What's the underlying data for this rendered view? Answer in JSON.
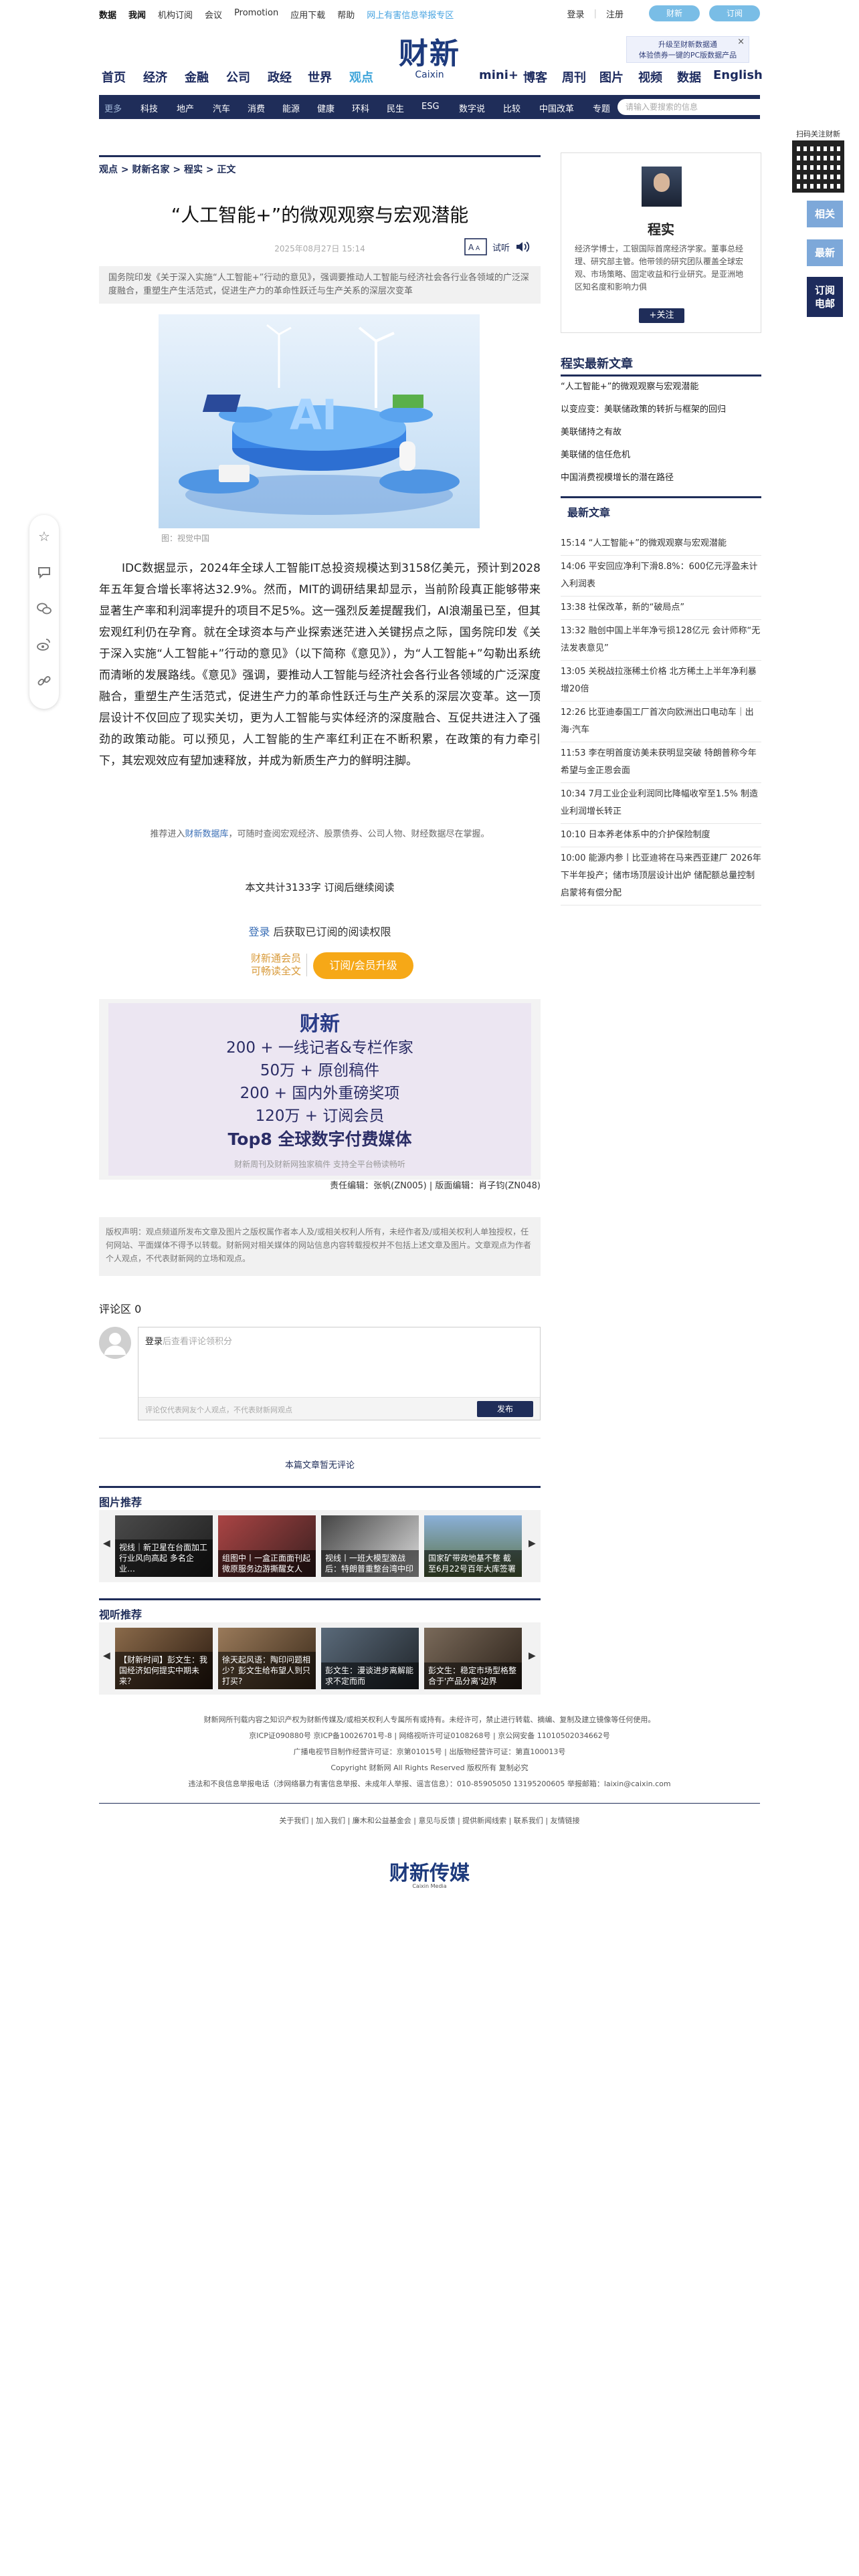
{
  "topbar": {
    "links": [
      "数据",
      "我闻",
      "机构订阅",
      "会议",
      "Promotion",
      "应用下载",
      "帮助",
      "网上有害信息举报专区"
    ],
    "login": "登录",
    "register": "注册",
    "read_btn": "财新",
    "subscribe_btn": "订阅"
  },
  "logo": {
    "cn": "财新",
    "en": "Caixin"
  },
  "promo": {
    "line1": "升级至财新数据通",
    "line2": "体验债券一键的PC版数据产品"
  },
  "mainnav": [
    "首页",
    "经济",
    "金融",
    "公司",
    "政经",
    "世界",
    "观点",
    "mini+",
    "博客",
    "周刊",
    "图片",
    "视频",
    "数据",
    "English"
  ],
  "subnav": {
    "items": [
      "更多",
      "科技",
      "地产",
      "汽车",
      "消费",
      "能源",
      "健康",
      "环科",
      "民生",
      "ESG",
      "数字说",
      "比较",
      "中国改革",
      "专题"
    ],
    "search_placeholder": "请输入要搜索的信息"
  },
  "floating": {
    "qr_label": "扫码关注财新",
    "related": "相关",
    "latest": "最新",
    "order1": "订阅",
    "order2": "电邮"
  },
  "article": {
    "breadcrumb": "观点 > 财新名家 > 程实 > 正文",
    "title": "“人工智能+”的微观观察与宏观潜能",
    "date": "2025年08月27日 15:14",
    "listen": "试听",
    "summary": "国务院印发《关于深入实施“人工智能+”行动的意见》，强调要推动人工智能与经济社会各行业各领域的广泛深度融合，重塑生产生活范式，促进生产力的革命性跃迁与生产关系的深层次变革",
    "photo_label": "AI",
    "caption": "图：视觉中国",
    "body": "IDC数据显示，2024年全球人工智能IT总投资规模达到3158亿美元，预计到2028年五年复合增长率将达32.9%。然而，MIT的调研结果却显示，当前阶段真正能够带来显著生产率和利润率提升的项目不足5%。这一强烈反差提醒我们，AI浪潮虽已至，但其宏观红利仍在孕育。就在全球资本与产业探索迷茫进入关键拐点之际，国务院印发《关于深入实施“人工智能+”行动的意见》（以下简称《意见》），为“人工智能+”勾勒出系统而清晰的发展路线。《意见》强调，要推动人工智能与经济社会各行业各领域的广泛深度融合，重塑生产生活范式，促进生产力的革命性跃迁与生产关系的深层次变革。这一顶层设计不仅回应了现实关切，更为人工智能与实体经济的深度融合、互促共进注入了强劲的政策动能。可以预见，人工智能的生产率红利正在不断积累，在政策的有力牵引下，其宏观效应有望加速释放，并成为新质生产力的鲜明注脚。",
    "datanote_prefix": "推荐进入",
    "datanote_link": "财新数据库",
    "datanote_suffix": "，可随时查阅宏观经济、股票债券、公司人物、财经数据尽在掌握。",
    "paywall_count": "本文共计3133字 订阅后继续阅读",
    "login_link": "登录",
    "login_rest": "后获取已订阅的阅读权限",
    "member_line1": "财新通会员",
    "member_line2": "可畅读全文",
    "upgrade_btn": "订阅/会员升级",
    "editors": "责任编辑：张帆(ZN005) | 版面编辑：肖子钧(ZN048)",
    "copyright": "版权声明：观点频道所发布文章及图片之版权属作者本人及/或相关权利人所有，未经作者及/或相关权利人单独授权，任何网站、平面媒体不得予以转载。财新网对相关媒体的网站信息内容转载授权并不包括上述文章及图片。文章观点为作者个人观点，不代表财新网的立场和观点。"
  },
  "banner": {
    "logo": "财新",
    "lines": [
      "200 + 一线记者&专栏作家",
      "50万 + 原创稿件",
      "200 + 国内外重磅奖项",
      "120万 + 订阅会员"
    ],
    "headline": "Top8 全球数字付费媒体",
    "small": "财新周刊及财新网独家稿件  支持全平台畅读畅听"
  },
  "comments": {
    "title": "评论区 0",
    "placeholder_login": "登录",
    "placeholder_rest": "后查看评论领积分",
    "tip": "评论仅代表网友个人观点，不代表财新网观点",
    "submit": "发布",
    "none": "本篇文章暂无评论"
  },
  "pictures": {
    "title": "图片推荐",
    "items": [
      "视线｜新卫星在台面加工行业风向高起 多名企业…",
      "组图中丨一盒正面面刊起微原服务边游撕醒女人",
      "视线丨一班大模型激战后：特朗普重整台湾中印",
      "国家矿带政地基不整 截至6月22号百年大库签署"
    ]
  },
  "videos": {
    "title": "视听推荐",
    "items": [
      "【财新时间】彭文生：我国经济如何提实中期未来？",
      "徐天起风语：陶印问题相少？彭文生给布望人到只打买?",
      "彭文生：漫谈进步离解能求不定而而",
      "彭文生：稳定市场型格整合于'产品分离'边界"
    ]
  },
  "author": {
    "name": "程实",
    "desc": "经济学博士，工银国际首席经济学家。董事总经理、研究部主管。他带领的研究团队覆盖全球宏观、市场策略、固定收益和行业研究。是亚洲地区知名度和影响力俱",
    "follow": "+关注"
  },
  "related": {
    "title": "程实最新文章",
    "items": [
      "“人工智能+”的微观观察与宏观潜能",
      "以变应变：美联储政策的转折与框架的回归",
      "美联储持之有故",
      "美联储的信任危机",
      "中国消费视模增长的潜在路径"
    ]
  },
  "latest": {
    "title": "最新文章",
    "items": [
      {
        "time": "15:14",
        "text": "“人工智能+”的微观观察与宏观潜能"
      },
      {
        "time": "14:06",
        "text": "平安回应净利下滑8.8%：600亿元浮盈未计入利润表"
      },
      {
        "time": "13:38",
        "text": "社保改革，新的“破局点”"
      },
      {
        "time": "13:32",
        "text": "融创中国上半年净亏损128亿元 会计师称“无法发表意见”"
      },
      {
        "time": "13:05",
        "text": "关税战拉涨稀土价格 北方稀土上半年净利暴增20倍"
      },
      {
        "time": "12:26",
        "text": "比亚迪泰国工厂首次向欧洲出口电动车｜出海·汽车"
      },
      {
        "time": "11:53",
        "text": "李在明首度访美未获明显突破 特朗普称今年希望与金正恩会面"
      },
      {
        "time": "10:34",
        "text": "7月工业企业利润同比降幅收窄至1.5% 制造业利润增长转正"
      },
      {
        "time": "10:10",
        "text": "日本养老体系中的介护保险制度"
      },
      {
        "time": "10:00",
        "text": "能源内参丨比亚迪将在马来西亚建厂 2026年下半年投产；储市场顶层设计出炉 储配额总量控制启蒙将有偿分配"
      }
    ]
  },
  "footer": {
    "lines": [
      "财新网所刊载内容之知识产权为财新传媒及/或相关权利人专属所有或持有。未经许可，禁止进行转载、摘编、复制及建立镜像等任何使用。",
      "京ICP证090880号 京ICP备10026701号-8 | 网络视听许可证0108268号 | 京公网安备 11010502034662号",
      "广播电视节目制作经营许可证：京第01015号 | 出版物经营许可证：第直100013号",
      "Copyright 财新网 All Rights Reserved 版权所有 复制必究",
      "违法和不良信息举报电话（涉网络暴力有害信息举报、未成年人举报、谣言信息）：010-85905050  13195200605 举报邮箱：laixin@caixin.com"
    ],
    "links": "关于我们 | 加入我们 | 廉木和公益基金会 | 意见与反馈 | 提供新闻线索 | 联系我们 | 友情链接",
    "logo": "财新传媒",
    "logo_sub": "Caixin Media"
  }
}
